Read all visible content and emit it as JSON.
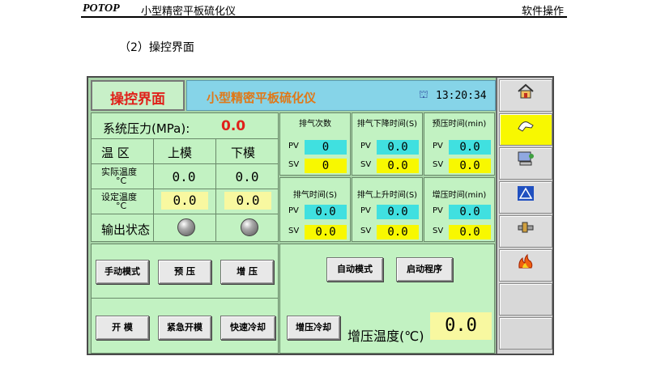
{
  "doc": {
    "brand": "POTOP",
    "title": "小型精密平板硫化仪",
    "section": "软件操作",
    "caption": "（2）操控界面"
  },
  "hmi": {
    "screen_title": "操控界面",
    "machine_name": "小型精密平板硫化仪",
    "clock": "13:20:34",
    "system_pressure_label": "系统压力(MPa):",
    "system_pressure_value": "0.0",
    "table": {
      "zone_label": "温  区",
      "upper_label": "上模",
      "lower_label": "下模",
      "actual_label": "实际温度",
      "actual_unit": "°C",
      "actual_upper": "0.0",
      "actual_lower": "0.0",
      "set_label": "设定温度",
      "set_unit": "°C",
      "set_upper": "0.0",
      "set_lower": "0.0",
      "output_label": "输出状态"
    },
    "params": [
      {
        "title": "排气次数",
        "pv_label": "PV",
        "pv": "0",
        "sv_label": "SV",
        "sv": "0"
      },
      {
        "title": "排气下降时间(S)",
        "pv_label": "PV",
        "pv": "0.0",
        "sv_label": "SV",
        "sv": "0.0"
      },
      {
        "title": "预压时间(min)",
        "pv_label": "PV",
        "pv": "0.0",
        "sv_label": "SV",
        "sv": "0.0"
      },
      {
        "title": "排气时间(S)",
        "pv_label": "PV",
        "pv": "0.0",
        "sv_label": "SV",
        "sv": "0.0"
      },
      {
        "title": "排气上升时间(S)",
        "pv_label": "PV",
        "pv": "0.0",
        "sv_label": "SV",
        "sv": "0.0"
      },
      {
        "title": "增压时间(min)",
        "pv_label": "PV",
        "pv": "0.0",
        "sv_label": "SV",
        "sv": "0.0"
      }
    ],
    "buttons": {
      "manual": "手动模式",
      "preload": "预 压",
      "boost": "增 压",
      "auto": "自动模式",
      "start_program": "启动程序",
      "open_mold": "开 模",
      "emergency_open": "紧急开模",
      "quick_cool": "快速冷却",
      "boost_cool": "增压冷却"
    },
    "boost_temp_label": "增压温度(℃)",
    "boost_temp_value": "0.0",
    "sidebar_icons": [
      "home-icon",
      "hand-icon",
      "computer-icon",
      "warning-icon",
      "tools-icon",
      "flame-icon"
    ]
  }
}
